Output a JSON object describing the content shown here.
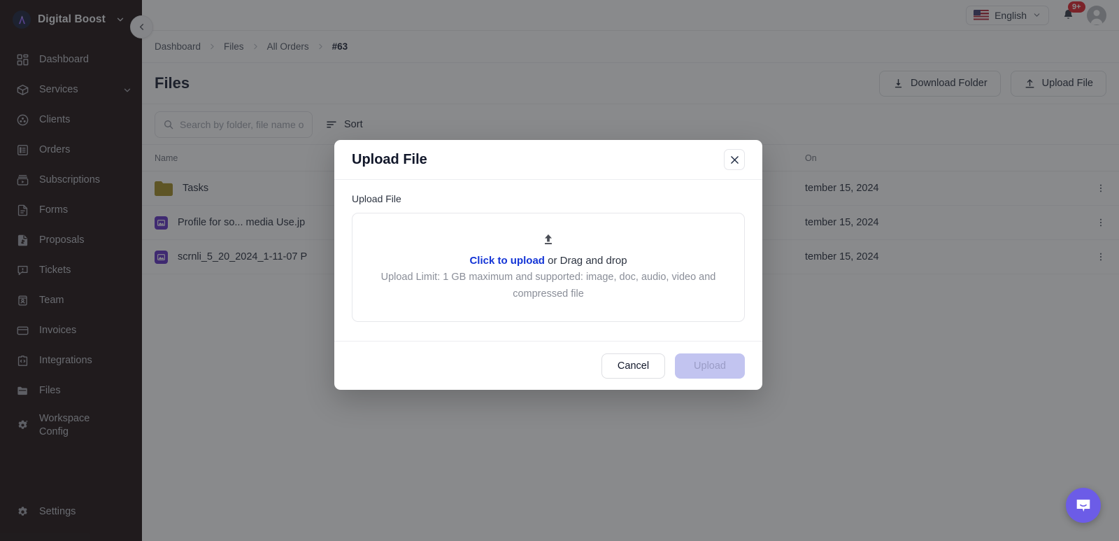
{
  "sidebar": {
    "brand": {
      "name": "Digital Boost",
      "logo_mark": "A",
      "caret_icon": "chevron-down-icon"
    },
    "items": [
      {
        "label": "Dashboard",
        "icon": "dashboard-icon"
      },
      {
        "label": "Services",
        "icon": "package-icon",
        "caret": "chevron-down-icon"
      },
      {
        "label": "Clients",
        "icon": "clients-icon"
      },
      {
        "label": "Orders",
        "icon": "orders-list-icon"
      },
      {
        "label": "Subscriptions",
        "icon": "subscriptions-icon"
      },
      {
        "label": "Forms",
        "icon": "form-document-icon"
      },
      {
        "label": "Proposals",
        "icon": "proposal-invoice-icon"
      },
      {
        "label": "Tickets",
        "icon": "ticket-chat-icon"
      },
      {
        "label": "Team",
        "icon": "team-badge-icon"
      },
      {
        "label": "Invoices",
        "icon": "credit-card-icon"
      },
      {
        "label": "Integrations",
        "icon": "integrations-icon"
      },
      {
        "label": "Files",
        "icon": "folder-icon"
      },
      {
        "label": "Workspace Config",
        "icon": "gear-sparkle-icon"
      }
    ],
    "bottom": {
      "label": "Settings",
      "icon": "gear-icon"
    },
    "collapse_button": "chevron-left-icon"
  },
  "topbar": {
    "language": {
      "value": "English",
      "flag": "us-flag-icon",
      "caret_icon": "chevron-down-icon"
    },
    "notifications": {
      "icon": "bell-icon",
      "badge": "9+"
    },
    "avatar": "user-avatar-icon"
  },
  "breadcrumb": {
    "items": [
      "Dashboard",
      "Files",
      "All Orders",
      "#63"
    ],
    "separator_icon": "chevron-right-icon"
  },
  "page": {
    "title": "Files",
    "actions": [
      {
        "label": "Download Folder",
        "icon": "download-icon"
      },
      {
        "label": "Upload File",
        "icon": "upload-icon"
      }
    ]
  },
  "toolbar": {
    "search": {
      "placeholder": "Search by folder, file name or si",
      "value": "",
      "icon": "search-icon"
    },
    "sort": {
      "label": "Sort",
      "icon": "sort-icon"
    }
  },
  "table": {
    "columns": {
      "name": "Name",
      "size": "",
      "by": "",
      "on": "On"
    },
    "rows": [
      {
        "name": "Tasks",
        "icon": "folder-icon",
        "size": "",
        "by": "",
        "on": "tember 15, 2024",
        "menu": "kebab-menu-icon"
      },
      {
        "name": "Profile for so... media Use.jp",
        "icon": "image-file-icon",
        "size": "",
        "by": "",
        "on": "tember 15, 2024",
        "menu": "kebab-menu-icon"
      },
      {
        "name": "scrnli_5_20_2024_1-11-07 P",
        "icon": "image-file-icon",
        "size": "",
        "by": "",
        "on": "tember 15, 2024",
        "menu": "kebab-menu-icon"
      }
    ]
  },
  "modal": {
    "title": "Upload File",
    "close_icon": "close-icon",
    "field_label": "Upload File",
    "dropzone": {
      "icon": "upload-arrow-icon",
      "link_text": "Click to upload",
      "rest_text": " or Drag and drop",
      "hint": "Upload Limit: 1 GB maximum and supported: image, doc, audio, video and compressed file"
    },
    "cancel_label": "Cancel",
    "upload_label": "Upload"
  },
  "intercom": {
    "icon": "chat-bubble-icon"
  },
  "colors": {
    "sidebar_bg": "#170a0a",
    "accent_link": "#1435d6",
    "upload_btn": "#c2c4f0",
    "badge_red": "#e01b24",
    "intercom_purple": "#6c5ce7",
    "folder_yellow": "#a08a1e",
    "image_icon_purple": "#5b2bc4"
  }
}
